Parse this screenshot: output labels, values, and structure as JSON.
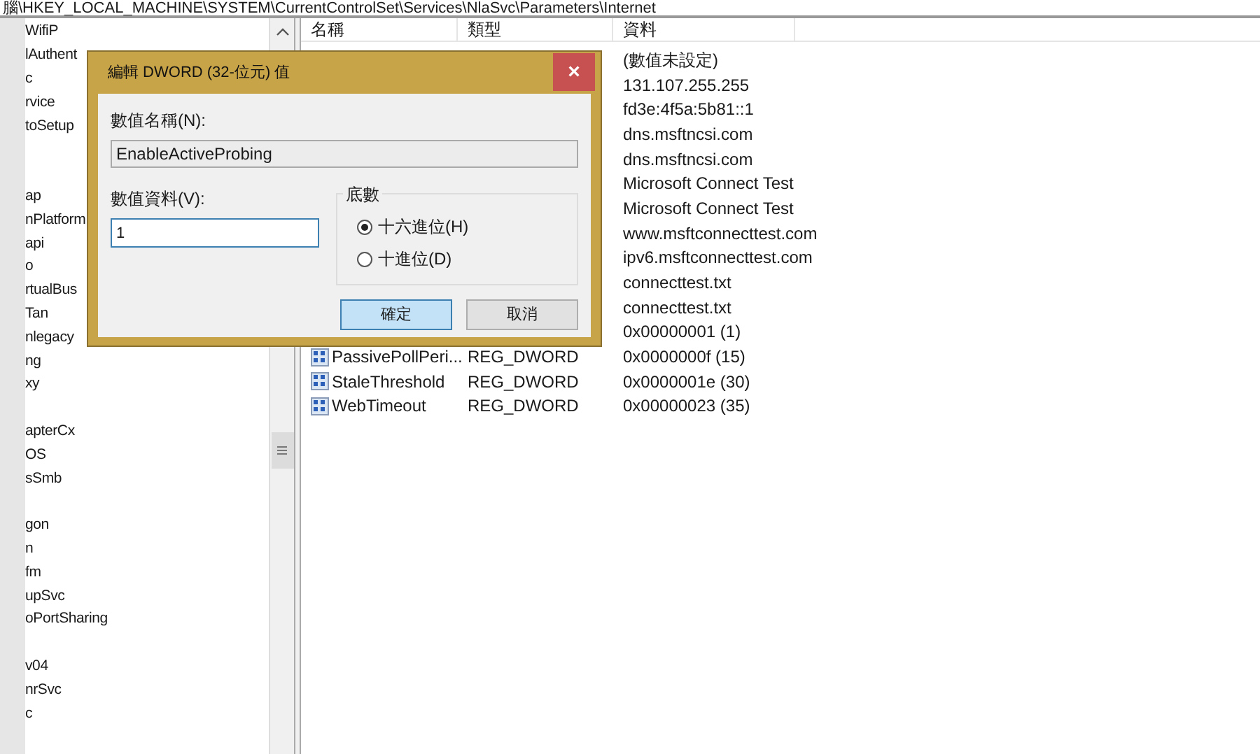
{
  "address_bar": {
    "path": "腦\\HKEY_LOCAL_MACHINE\\SYSTEM\\CurrentControlSet\\Services\\NlaSvc\\Parameters\\Internet"
  },
  "tree": {
    "items": [
      {
        "kind": "text",
        "text": "WifiP"
      },
      {
        "kind": "text",
        "text": "lAuthent"
      },
      {
        "kind": "text",
        "text": "c"
      },
      {
        "kind": "text",
        "text": "rvice"
      },
      {
        "kind": "text",
        "text": "toSetup"
      },
      {
        "kind": "blank"
      },
      {
        "kind": "blank"
      },
      {
        "kind": "text",
        "text": "ap"
      },
      {
        "kind": "text",
        "text": "nPlatform"
      },
      {
        "kind": "text",
        "text": "api"
      },
      {
        "kind": "text",
        "text": "o"
      },
      {
        "kind": "text",
        "text": "rtualBus"
      },
      {
        "kind": "text",
        "text": "Tan"
      },
      {
        "kind": "text",
        "text": "nlegacy"
      },
      {
        "kind": "text",
        "text": "ng"
      },
      {
        "kind": "text",
        "text": "xy"
      },
      {
        "kind": "blank"
      },
      {
        "kind": "text",
        "text": "apterCx"
      },
      {
        "kind": "text",
        "text": "OS"
      },
      {
        "kind": "text",
        "text": "sSmb"
      },
      {
        "kind": "blank"
      },
      {
        "kind": "text",
        "text": "gon"
      },
      {
        "kind": "text",
        "text": "n"
      },
      {
        "kind": "text",
        "text": "fm"
      },
      {
        "kind": "text",
        "text": "upSvc"
      },
      {
        "kind": "text",
        "text": "oPortSharing"
      },
      {
        "kind": "blank"
      },
      {
        "kind": "text",
        "text": "v04"
      },
      {
        "kind": "text",
        "text": "nrSvc"
      },
      {
        "kind": "text",
        "text": "c"
      }
    ]
  },
  "values_table": {
    "columns": [
      "名稱",
      "類型",
      "資料"
    ],
    "rows": [
      {
        "data": "(數值未設定)"
      },
      {
        "data": "131.107.255.255"
      },
      {
        "data": "fd3e:4f5a:5b81::1"
      },
      {
        "data": "dns.msftncsi.com"
      },
      {
        "data": "dns.msftncsi.com"
      },
      {
        "data": "Microsoft Connect Test"
      },
      {
        "data": "Microsoft Connect Test"
      },
      {
        "data": "www.msftconnecttest.com"
      },
      {
        "data": "ipv6.msftconnecttest.com"
      },
      {
        "data": "connecttest.txt"
      },
      {
        "data": "connecttest.txt"
      },
      {
        "data": "0x00000001 (1)"
      },
      {
        "name": "PassivePollPeri...",
        "type": "REG_DWORD",
        "data": "0x0000000f (15)"
      },
      {
        "name": "StaleThreshold",
        "type": "REG_DWORD",
        "data": "0x0000001e (30)"
      },
      {
        "name": "WebTimeout",
        "type": "REG_DWORD",
        "data": "0x00000023 (35)"
      }
    ]
  },
  "dialog": {
    "title": "編輯 DWORD (32-位元) 值",
    "close": "×",
    "name_label": "數值名稱(N):",
    "name_value": "EnableActiveProbing",
    "data_label": "數值資料(V):",
    "data_value": "1",
    "base_group": {
      "title": "底數",
      "options": [
        {
          "label": "十六進位(H)",
          "selected": true
        },
        {
          "label": "十進位(D)",
          "selected": false
        }
      ]
    },
    "buttons": [
      {
        "label": "確定",
        "default": true
      },
      {
        "label": "取消",
        "default": false
      }
    ]
  }
}
